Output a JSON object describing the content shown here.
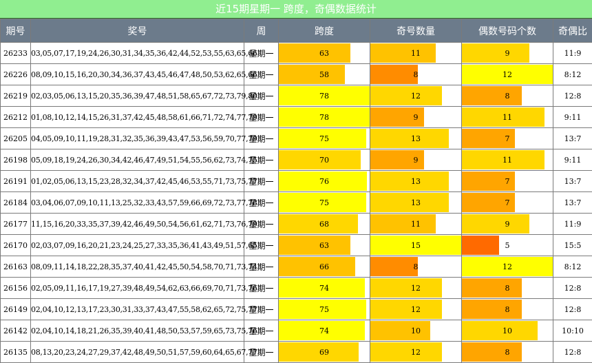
{
  "title": "近15期星期一 跨度，奇偶数据统计",
  "headers": [
    "期号",
    "奖号",
    "周",
    "跨度",
    "奇号数量",
    "偶数号码个数",
    "奇偶比"
  ],
  "colors": {
    "title_bg": "#90ee90",
    "header_bg": "#6c7b8b",
    "level_1": "#ffff00",
    "level_2": "#ffd700",
    "level_3": "#ffc200",
    "level_4": "#ffa500",
    "level_5": "#ff8c00",
    "level_6": "#ff6a00"
  },
  "rows": [
    {
      "issue": "26233",
      "numbers": "03,05,07,17,19,24,26,30,31,34,35,36,42,44,52,53,55,63,65,66",
      "week": "星期一",
      "span": "63",
      "odd": "11",
      "even": "9",
      "ratio": "11:9",
      "span_frac": 0.79,
      "odd_frac": 0.72,
      "even_frac": 0.74,
      "span_color": "#ffc200",
      "odd_color": "#ffc200",
      "even_color": "#ffd700"
    },
    {
      "issue": "26226",
      "numbers": "08,09,10,15,16,20,30,34,36,37,43,45,46,47,48,50,53,62,65,66",
      "week": "星期一",
      "span": "58",
      "odd": "8",
      "even": "12",
      "ratio": "8:12",
      "span_frac": 0.73,
      "odd_frac": 0.52,
      "even_frac": 1.0,
      "span_color": "#ffc200",
      "odd_color": "#ff8c00",
      "even_color": "#ffff00"
    },
    {
      "issue": "26219",
      "numbers": "02,03,05,06,13,15,20,35,36,39,47,48,51,58,65,67,72,73,79,80",
      "week": "星期一",
      "span": "78",
      "odd": "12",
      "even": "8",
      "ratio": "12:8",
      "span_frac": 1.0,
      "odd_frac": 0.79,
      "even_frac": 0.66,
      "span_color": "#ffff00",
      "odd_color": "#ffd700",
      "even_color": "#ffa500"
    },
    {
      "issue": "26212",
      "numbers": "01,08,10,12,14,15,26,31,37,42,45,48,58,61,66,71,72,74,77,79",
      "week": "星期一",
      "span": "78",
      "odd": "9",
      "even": "11",
      "ratio": "9:11",
      "span_frac": 1.0,
      "odd_frac": 0.59,
      "even_frac": 0.91,
      "span_color": "#ffff00",
      "odd_color": "#ffa500",
      "even_color": "#ffd700"
    },
    {
      "issue": "26205",
      "numbers": "04,05,09,10,11,19,28,31,32,35,36,39,43,47,53,56,59,70,77,79",
      "week": "星期一",
      "span": "75",
      "odd": "13",
      "even": "7",
      "ratio": "13:7",
      "span_frac": 0.96,
      "odd_frac": 0.86,
      "even_frac": 0.58,
      "span_color": "#ffff00",
      "odd_color": "#ffd700",
      "even_color": "#ffa500"
    },
    {
      "issue": "26198",
      "numbers": "05,09,18,19,24,26,30,34,42,46,47,49,51,54,55,56,62,73,74,75",
      "week": "星期一",
      "span": "70",
      "odd": "9",
      "even": "11",
      "ratio": "9:11",
      "span_frac": 0.9,
      "odd_frac": 0.59,
      "even_frac": 0.91,
      "span_color": "#ffd700",
      "odd_color": "#ffa500",
      "even_color": "#ffd700"
    },
    {
      "issue": "26191",
      "numbers": "01,02,05,06,13,15,23,28,32,34,37,42,45,46,53,55,71,73,75,77",
      "week": "星期一",
      "span": "76",
      "odd": "13",
      "even": "7",
      "ratio": "13:7",
      "span_frac": 0.97,
      "odd_frac": 0.86,
      "even_frac": 0.58,
      "span_color": "#ffff00",
      "odd_color": "#ffd700",
      "even_color": "#ffa500"
    },
    {
      "issue": "26184",
      "numbers": "03,04,06,07,09,10,11,13,25,32,33,43,57,59,66,69,72,73,77,78",
      "week": "星期一",
      "span": "75",
      "odd": "13",
      "even": "7",
      "ratio": "13:7",
      "span_frac": 0.96,
      "odd_frac": 0.86,
      "even_frac": 0.58,
      "span_color": "#ffff00",
      "odd_color": "#ffd700",
      "even_color": "#ffa500"
    },
    {
      "issue": "26177",
      "numbers": "11,15,16,20,33,35,37,39,42,46,49,50,54,56,61,62,71,73,76,79",
      "week": "星期一",
      "span": "68",
      "odd": "11",
      "even": "9",
      "ratio": "11:9",
      "span_frac": 0.87,
      "odd_frac": 0.72,
      "even_frac": 0.74,
      "span_color": "#ffd700",
      "odd_color": "#ffc200",
      "even_color": "#ffd700"
    },
    {
      "issue": "26170",
      "numbers": "02,03,07,09,16,20,21,23,24,25,27,33,35,36,41,43,49,51,57,65",
      "week": "星期一",
      "span": "63",
      "odd": "15",
      "even": "5",
      "ratio": "15:5",
      "span_frac": 0.79,
      "odd_frac": 1.0,
      "even_frac": 0.41,
      "span_color": "#ffc200",
      "odd_color": "#ffff00",
      "even_color": "#ff6a00"
    },
    {
      "issue": "26163",
      "numbers": "08,09,11,14,18,22,28,35,37,40,41,42,45,50,54,58,70,71,73,74",
      "week": "星期一",
      "span": "66",
      "odd": "8",
      "even": "12",
      "ratio": "8:12",
      "span_frac": 0.84,
      "odd_frac": 0.52,
      "even_frac": 1.0,
      "span_color": "#ffc200",
      "odd_color": "#ff8c00",
      "even_color": "#ffff00"
    },
    {
      "issue": "26156",
      "numbers": "02,05,09,11,16,17,19,27,39,48,49,54,62,63,66,69,70,71,73,76",
      "week": "星期一",
      "span": "74",
      "odd": "12",
      "even": "8",
      "ratio": "12:8",
      "span_frac": 0.95,
      "odd_frac": 0.79,
      "even_frac": 0.66,
      "span_color": "#ffff00",
      "odd_color": "#ffd700",
      "even_color": "#ffa500"
    },
    {
      "issue": "26149",
      "numbers": "02,04,10,12,13,17,23,30,31,33,37,43,47,55,58,62,65,72,75,77",
      "week": "星期一",
      "span": "75",
      "odd": "12",
      "even": "8",
      "ratio": "12:8",
      "span_frac": 0.96,
      "odd_frac": 0.79,
      "even_frac": 0.66,
      "span_color": "#ffff00",
      "odd_color": "#ffd700",
      "even_color": "#ffa500"
    },
    {
      "issue": "26142",
      "numbers": "02,04,10,14,18,21,26,35,39,40,41,48,50,53,57,59,65,73,75,76",
      "week": "星期一",
      "span": "74",
      "odd": "10",
      "even": "10",
      "ratio": "10:10",
      "span_frac": 0.95,
      "odd_frac": 0.66,
      "even_frac": 0.83,
      "span_color": "#ffff00",
      "odd_color": "#ffc200",
      "even_color": "#ffd700"
    },
    {
      "issue": "26135",
      "numbers": "08,13,20,23,24,27,29,37,42,48,49,50,51,57,59,60,64,65,67,77",
      "week": "星期一",
      "span": "69",
      "odd": "12",
      "even": "8",
      "ratio": "12:8",
      "span_frac": 0.88,
      "odd_frac": 0.79,
      "even_frac": 0.66,
      "span_color": "#ffd700",
      "odd_color": "#ffd700",
      "even_color": "#ffa500"
    }
  ]
}
